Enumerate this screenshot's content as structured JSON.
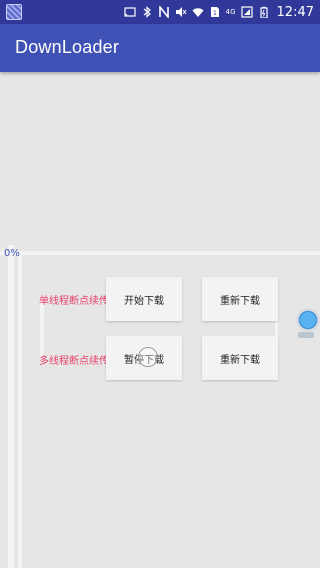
{
  "status_bar": {
    "time": "12:47",
    "network_label": "4G",
    "icons": [
      "notification-icon",
      "cast-icon",
      "bluetooth-icon",
      "nfc-icon",
      "mute-icon",
      "wifi-icon",
      "sim-icon",
      "signal-icon",
      "battery-icon"
    ]
  },
  "app_bar": {
    "title": "DownLoader",
    "color": "#3f51b5"
  },
  "progress": {
    "text": "0%",
    "value": 0
  },
  "rows": [
    {
      "label": "单线程断点续传",
      "start_label": "开始下载",
      "restart_label": "重新下载"
    },
    {
      "label": "多线程断点续传",
      "pause_label": "暂停下载",
      "restart_label": "重新下载"
    }
  ],
  "colors": {
    "accent": "#e8416b",
    "background": "#e6e6e6"
  }
}
